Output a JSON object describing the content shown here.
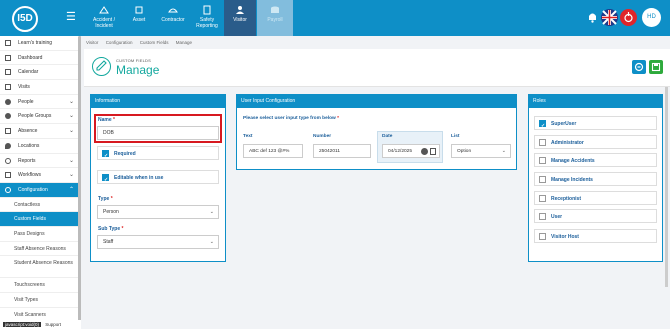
{
  "topbar": {
    "logo": "I5D",
    "nav": [
      {
        "label": "Accident / Incident"
      },
      {
        "label": "Asset"
      },
      {
        "label": "Contractor"
      },
      {
        "label": "Safety Reporting"
      },
      {
        "label": "Visitor"
      },
      {
        "label": "Payroll"
      }
    ],
    "avatar": "HD",
    "colors": {
      "bar": "#0e8fc7",
      "accent": "#13a89e"
    }
  },
  "sidebar": {
    "items": [
      {
        "label": "Learn's training"
      },
      {
        "label": "Dashboard"
      },
      {
        "label": "Calendar"
      },
      {
        "label": "Visits"
      },
      {
        "label": "People"
      },
      {
        "label": "People Groups"
      },
      {
        "label": "Absence"
      },
      {
        "label": "Locations"
      },
      {
        "label": "Reports"
      },
      {
        "label": "Workflows"
      },
      {
        "label": "Configuration"
      }
    ],
    "subitems": [
      {
        "label": "Contactless"
      },
      {
        "label": "Custom Fields"
      },
      {
        "label": "Pass Designs"
      },
      {
        "label": "Staff Absence Reasons"
      },
      {
        "label": "Student Absence Reasons"
      },
      {
        "label": "Touchscreens"
      },
      {
        "label": "Visit Types"
      },
      {
        "label": "Visit Scanners"
      }
    ],
    "footer_url": "javascript:void(0)",
    "footer_label": "Support"
  },
  "breadcrumb": [
    "Visitor",
    "Configuration",
    "Custom Fields",
    "Manage"
  ],
  "header": {
    "subtitle": "CUSTOM FIELDS",
    "title": "Manage"
  },
  "information": {
    "heading": "Information",
    "name_label": "Name",
    "name_value": "DOB",
    "required_label": "Required",
    "editable_label": "Editable when in use",
    "type_label": "Type",
    "type_value": "Person",
    "subtype_label": "Sub Type",
    "subtype_value": "Staff"
  },
  "user_input": {
    "heading": "User Input Configuration",
    "prompt": "Please select user input type from below",
    "types": [
      {
        "label": "Text",
        "value": "ABC def 123 @#%"
      },
      {
        "label": "Number",
        "value": "25042011"
      },
      {
        "label": "Date",
        "value": "04/12/2025"
      },
      {
        "label": "List",
        "value": "Option"
      }
    ]
  },
  "roles": {
    "heading": "Roles",
    "items": [
      {
        "label": "SuperUser",
        "checked": true
      },
      {
        "label": "Administrator",
        "checked": false
      },
      {
        "label": "Manage Accidents",
        "checked": false
      },
      {
        "label": "Manage Incidents",
        "checked": false
      },
      {
        "label": "Receptionist",
        "checked": false
      },
      {
        "label": "User",
        "checked": false
      },
      {
        "label": "Visitor Host",
        "checked": false
      }
    ]
  }
}
